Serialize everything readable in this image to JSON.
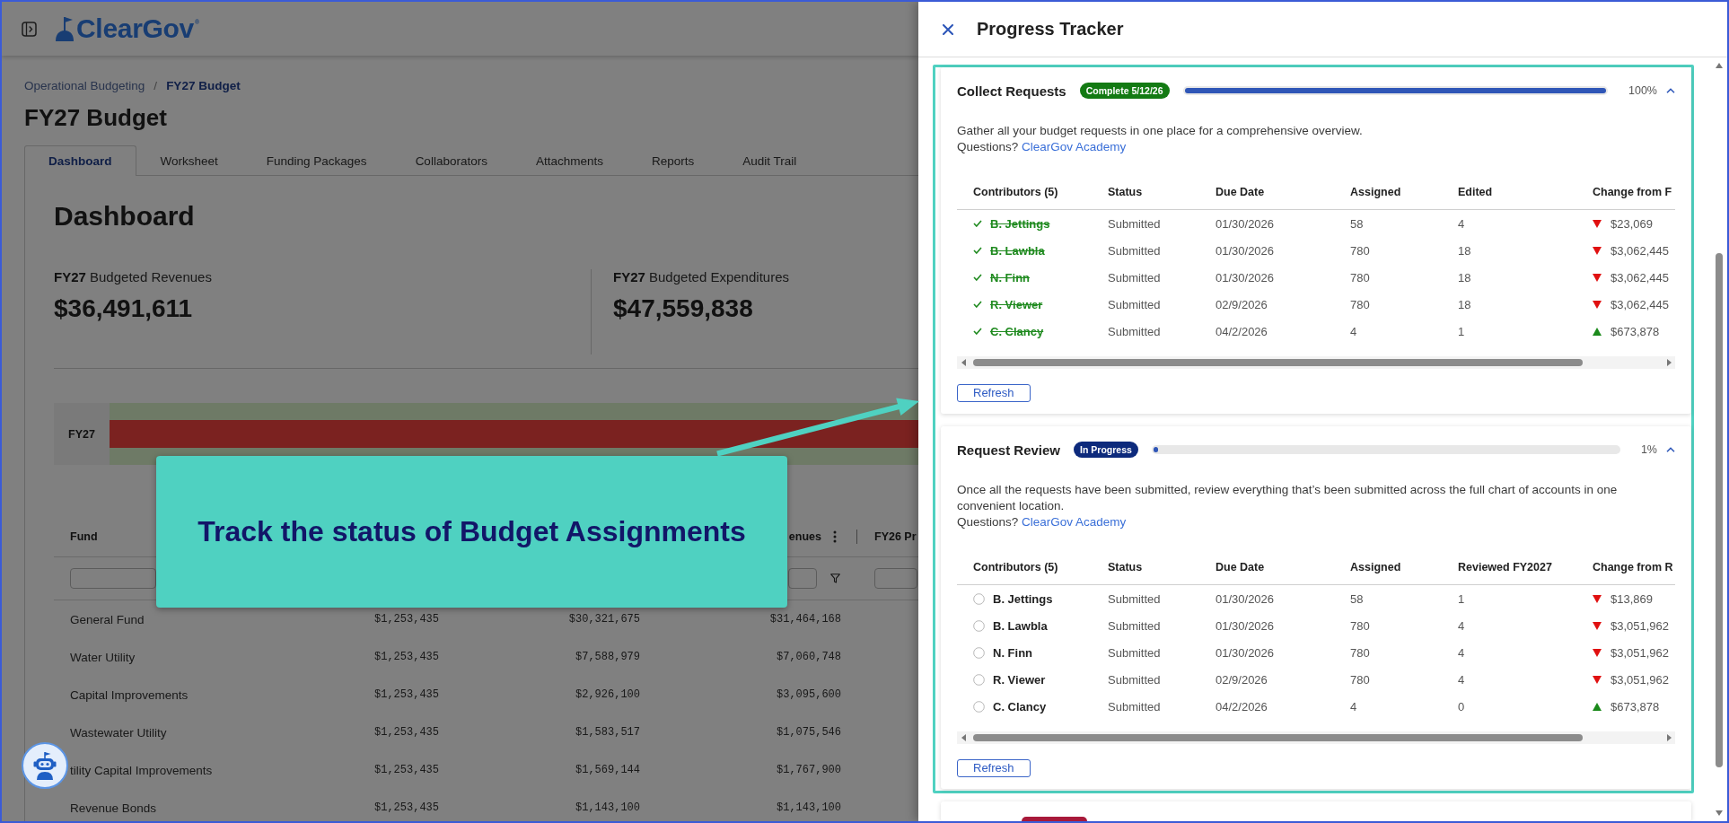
{
  "app_header": {
    "logo": "ClearGov$^{®}$"
  },
  "breadcrumb": {
    "items": [
      {
        "label": "Operational Budgeting",
        "current": false
      },
      {
        "label": "FY27 Budget",
        "current": true
      }
    ],
    "separator": "/"
  },
  "page_title": "FY27 Budget",
  "tabs": [
    {
      "label": "Dashboard",
      "selected": true
    },
    {
      "label": "Worksheet",
      "selected": false
    },
    {
      "label": "Funding Packages",
      "selected": false
    },
    {
      "label": "Collaborators",
      "selected": false
    },
    {
      "label": "Attachments",
      "selected": false
    },
    {
      "label": "Reports",
      "selected": false
    },
    {
      "label": "Audit Trail",
      "selected": false
    }
  ],
  "dashboard": {
    "title": "Dashboard",
    "kpis": [
      {
        "label": "**FY27** Budgeted Revenues",
        "value": "$36,491,611"
      },
      {
        "label": "**FY27** Budgeted Expenditures",
        "value": "$47,559,838"
      }
    ],
    "chart_row_label": "FY27"
  },
  "fund_table": {
    "headers": {
      "fund": "Fund",
      "column_4": "enues",
      "column_5": "FY26 Pr"
    },
    "rows": [
      {
        "fund": "General Fund",
        "column_2": "$1,253,435",
        "column_3": "$30,321,675",
        "column_4": "$31,464,168"
      },
      {
        "fund": "Water Utility",
        "column_2": "$1,253,435",
        "column_3": "$7,588,979",
        "column_4": "$7,060,748"
      },
      {
        "fund": "Capital Improvements",
        "column_2": "$1,253,435",
        "column_3": "$2,926,100",
        "column_4": "$3,095,600"
      },
      {
        "fund": "Wastewater Utility",
        "column_2": "$1,253,435",
        "column_3": "$1,583,517",
        "column_4": "$1,075,546"
      },
      {
        "fund": "tility Capital Improvements",
        "column_2": "$1,253,435",
        "column_3": "$1,569,144",
        "column_4": "$1,767,900"
      },
      {
        "fund": "Revenue Bonds",
        "column_2": "$1,253,435",
        "column_3": "$1,143,100",
        "column_4": "$1,143,100"
      }
    ]
  },
  "callout": {
    "text": "Track the status of Budget Assignments"
  },
  "progress_tracker": {
    "title": "Progress Tracker",
    "steps": [
      {
        "title": "Collect Requests",
        "status": "Complete 5/12/26",
        "color": "#137a13",
        "level": 1,
        "percent": "100%",
        "expanded": true,
        "description": "Gather all your budget requests in one place for a comprehensive overview.",
        "help": "Questions?",
        "link": "ClearGov Academy",
        "columns": [
          "Contributors (5)",
          "Status",
          "Due Date",
          "Assigned",
          "Edited",
          "Change from F"
        ],
        "rows": [
          {
            "contributor": "B. Jettings",
            "completed": true,
            "status": "Submitted",
            "due_date": "01/30/2026",
            "assigned": "58",
            "count": "4",
            "increase": false,
            "change": "$23,069"
          },
          {
            "contributor": "B. Lawbla",
            "completed": true,
            "status": "Submitted",
            "due_date": "01/30/2026",
            "assigned": "780",
            "count": "18",
            "increase": false,
            "change": "$3,062,445"
          },
          {
            "contributor": "N. Finn",
            "completed": true,
            "status": "Submitted",
            "due_date": "01/30/2026",
            "assigned": "780",
            "count": "18",
            "increase": false,
            "change": "$3,062,445"
          },
          {
            "contributor": "R. Viewer",
            "completed": true,
            "status": "Submitted",
            "due_date": "02/9/2026",
            "assigned": "780",
            "count": "18",
            "increase": false,
            "change": "$3,062,445"
          },
          {
            "contributor": "C. Clancy",
            "completed": true,
            "status": "Submitted",
            "due_date": "04/2/2026",
            "assigned": "4",
            "count": "1",
            "increase": true,
            "change": "$673,878"
          }
        ],
        "refresh": "Refresh"
      },
      {
        "title": "Request Review",
        "status": "In Progress",
        "color": "#0d2a7c",
        "level": 0.01,
        "percent": "1%",
        "expanded": true,
        "description": "Once all the requests have been submitted, review everything that’s been submitted across the full chart of accounts in one convenient location.",
        "help": "Questions?",
        "link": "ClearGov Academy",
        "columns": [
          "Contributors (5)",
          "Status",
          "Due Date",
          "Assigned",
          "Reviewed FY2027",
          "Change from R"
        ],
        "rows": [
          {
            "contributor": "B. Jettings",
            "completed": false,
            "status": "Submitted",
            "due_date": "01/30/2026",
            "assigned": "58",
            "count": "1",
            "increase": false,
            "change": "$13,869"
          },
          {
            "contributor": "B. Lawbla",
            "completed": false,
            "status": "Submitted",
            "due_date": "01/30/2026",
            "assigned": "780",
            "count": "4",
            "increase": false,
            "change": "$3,051,962"
          },
          {
            "contributor": "N. Finn",
            "completed": false,
            "status": "Submitted",
            "due_date": "01/30/2026",
            "assigned": "780",
            "count": "4",
            "increase": false,
            "change": "$3,051,962"
          },
          {
            "contributor": "R. Viewer",
            "completed": false,
            "status": "Submitted",
            "due_date": "02/9/2026",
            "assigned": "780",
            "count": "4",
            "increase": false,
            "change": "$3,051,962"
          },
          {
            "contributor": "C. Clancy",
            "completed": false,
            "status": "Submitted",
            "due_date": "04/2/2026",
            "assigned": "4",
            "count": "0",
            "increase": true,
            "change": "$673,878"
          }
        ],
        "refresh": "Refresh"
      },
      {
        "color": "#a8193a"
      }
    ]
  }
}
